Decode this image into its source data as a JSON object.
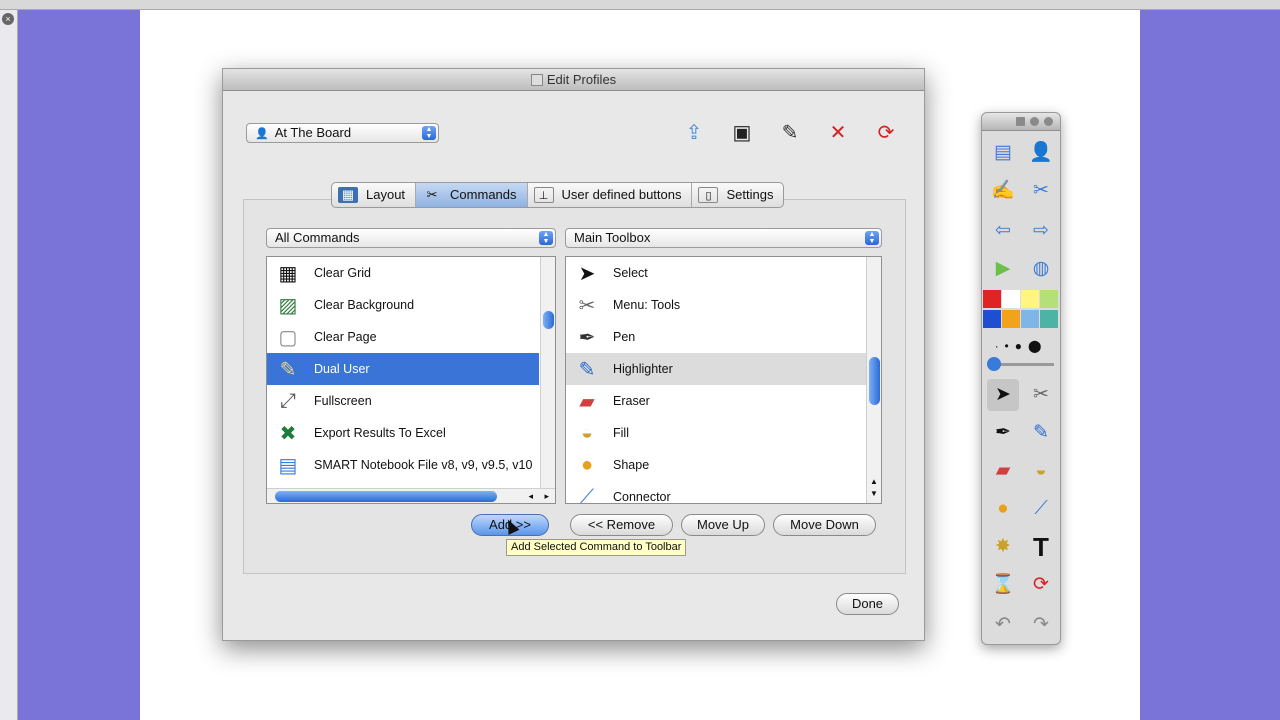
{
  "dialog": {
    "title": "Edit Profiles",
    "profile_select": "At The Board",
    "toolbar_icons": [
      "upload-icon",
      "save-icon",
      "save-as-icon",
      "delete-icon",
      "refresh-icon"
    ],
    "tabs": [
      {
        "label": "Layout",
        "icon": "layout-icon"
      },
      {
        "label": "Commands",
        "icon": "tools-icon",
        "active": true
      },
      {
        "label": "User defined buttons",
        "icon": "user-button-icon"
      },
      {
        "label": "Settings",
        "icon": "settings-icon"
      }
    ],
    "left_filter": "All Commands",
    "right_filter": "Main Toolbox",
    "left_items": [
      {
        "label": "Clear Grid",
        "icon": "grid-icon"
      },
      {
        "label": "Clear Background",
        "icon": "background-icon"
      },
      {
        "label": "Clear Page",
        "icon": "page-icon"
      },
      {
        "label": "Dual User",
        "icon": "dual-pen-icon",
        "selected": true
      },
      {
        "label": "Fullscreen",
        "icon": "fullscreen-icon"
      },
      {
        "label": "Export Results To Excel",
        "icon": "excel-icon"
      },
      {
        "label": "SMART Notebook File v8, v9, v9.5, v10",
        "icon": "notebook-file-icon"
      }
    ],
    "right_items": [
      {
        "label": "Select",
        "icon": "pointer-icon"
      },
      {
        "label": "Menu: Tools",
        "icon": "tools-icon"
      },
      {
        "label": "Pen",
        "icon": "pen-icon"
      },
      {
        "label": "Highlighter",
        "icon": "highlighter-icon",
        "highlighted": true
      },
      {
        "label": "Eraser",
        "icon": "eraser-icon"
      },
      {
        "label": "Fill",
        "icon": "fill-icon"
      },
      {
        "label": "Shape",
        "icon": "shape-icon"
      },
      {
        "label": "Connector",
        "icon": "connector-icon"
      }
    ],
    "buttons": {
      "add": "Add >>",
      "remove": "<< Remove",
      "move_up": "Move Up",
      "move_down": "Move Down",
      "done": "Done"
    },
    "tooltip": "Add Selected Command to Toolbar"
  },
  "toolbox": {
    "colors": [
      "#e02424",
      "#ffffff",
      "#fff580",
      "#b4e07a",
      "#1e4fd0",
      "#f2a31b",
      "#7fb6e8",
      "#4db3a4"
    ]
  }
}
